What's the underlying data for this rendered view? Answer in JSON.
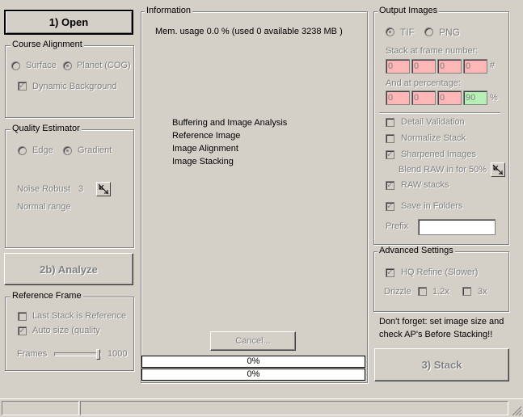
{
  "buttons": {
    "open": "1) Open",
    "analyze": "2b) Analyze",
    "cancel": "Cancel...",
    "stack": "3) Stack"
  },
  "course_alignment": {
    "title": "Course Alignment",
    "surface": "Surface",
    "planet": "Planet (COG)",
    "dynamic_background": "Dynamic Background"
  },
  "quality_estimator": {
    "title": "Quality Estimator",
    "edge": "Edge",
    "gradient": "Gradient",
    "noise_robust_label": "Noise Robust",
    "noise_robust_value": "3",
    "normal_range": "Normal range"
  },
  "reference_frame": {
    "title": "Reference Frame",
    "last_stack": "Last Stack is Reference",
    "auto_size": "Auto size (quality",
    "frames_label": "Frames",
    "frames_value": "1000"
  },
  "information": {
    "title": "Information",
    "mem_usage": "Mem. usage 0.0 %  (used 0 available 3238 MB )",
    "steps": [
      "Buffering and Image Analysis",
      "Reference Image",
      "Image Alignment",
      "Image Stacking"
    ],
    "progress1": "0%",
    "progress2": "0%"
  },
  "output_images": {
    "title": "Output Images",
    "tif": "TIF",
    "png": "PNG",
    "stack_at_frame": "Stack at frame number:",
    "frame_values": [
      "0",
      "0",
      "0",
      "0"
    ],
    "frame_suffix": "#",
    "at_percentage": "And at percentage:",
    "pct_values": [
      "0",
      "0",
      "0",
      "90"
    ],
    "pct_suffix": "%",
    "detail_validation": "Detail Validation",
    "normalize_stack": "Normalize Stack",
    "sharpened_images": "Sharpened Images",
    "blend_raw": "Blend RAW in for 50%",
    "raw_stacks": "RAW stacks",
    "save_in_folders": "Save in Folders",
    "prefix_label": "Prefix",
    "prefix_value": ""
  },
  "advanced_settings": {
    "title": "Advanced Settings",
    "hq_refine": "HQ Refine (Slower)",
    "drizzle_label": "Drizzle",
    "drizzle_1_5": "1.2x",
    "drizzle_3": "3x"
  },
  "note": "Don't forget: set image size and check AP's Before Stacking!!",
  "icons": {
    "tool_icon": "diagonal-arrow-icon",
    "resize_grip": "resize-grip-icon"
  }
}
